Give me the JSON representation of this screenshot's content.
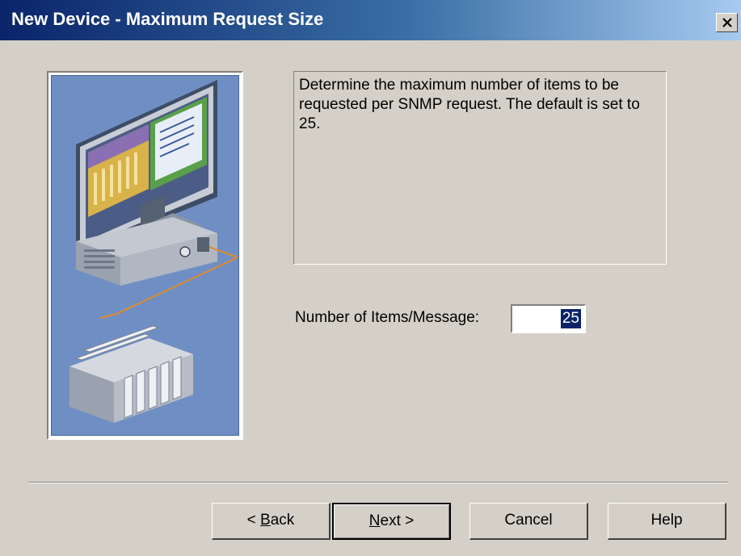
{
  "window": {
    "title": "New Device - Maximum Request Size",
    "close_icon": "close-icon"
  },
  "description": "Determine the maximum number of items to be requested per SNMP request. The default is set to 25.",
  "field": {
    "label": "Number of Items/Message:",
    "value": "25"
  },
  "buttons": {
    "back": {
      "prefix": "< ",
      "accel": "B",
      "rest": "ack"
    },
    "next": {
      "accel": "N",
      "rest": "ext >"
    },
    "cancel": "Cancel",
    "help": "Help"
  },
  "illustration": {
    "icon": "computer-and-plc-illustration",
    "accent": "#6f8fc4"
  }
}
